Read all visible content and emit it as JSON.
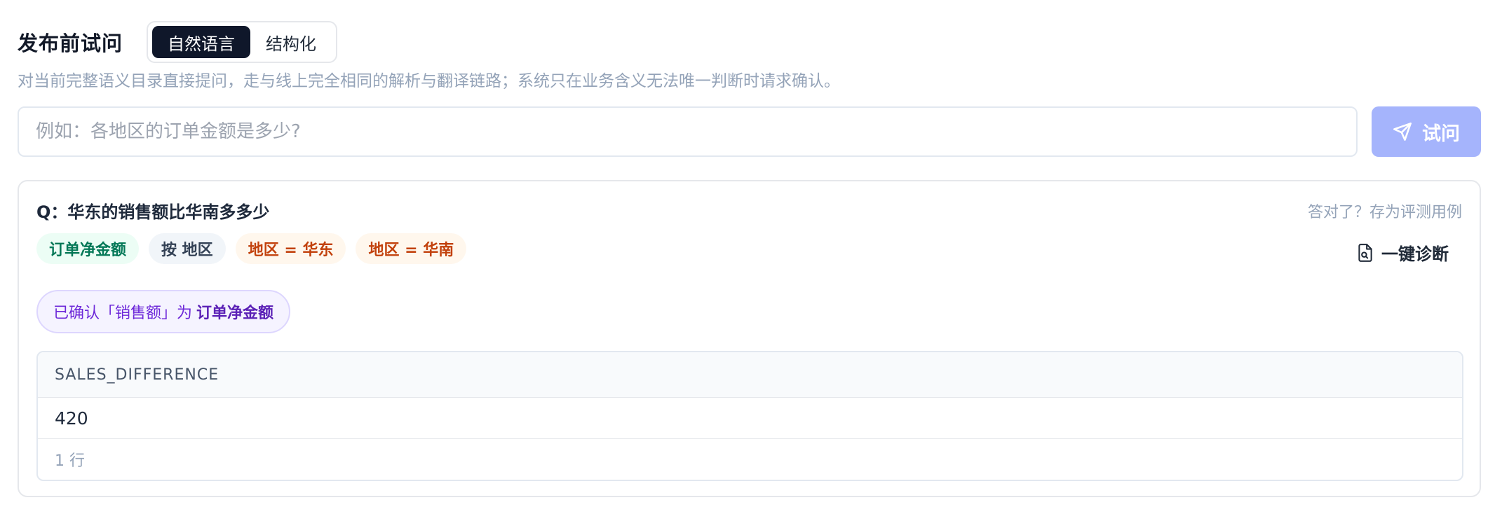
{
  "header": {
    "title": "发布前试问",
    "mode_tabs": [
      {
        "label": "自然语言",
        "active": true
      },
      {
        "label": "结构化",
        "active": false
      }
    ],
    "subtitle": "对当前完整语义目录直接提问，走与线上完全相同的解析与翻译链路；系统只在业务含义无法唯一判断时请求确认。"
  },
  "query": {
    "placeholder": "例如：各地区的订单金额是多少?",
    "value": "",
    "ask_label": "试问",
    "ask_icon": "send-icon",
    "ask_color": "#a5b4fc"
  },
  "result": {
    "question": "Q：华东的销售额比华南多多少",
    "save_label": "答对了？存为评测用例",
    "chips": [
      {
        "label": "订单净金额",
        "kind": "metric"
      },
      {
        "label": "按 地区",
        "kind": "dimension"
      },
      {
        "label": "地区 = 华东",
        "kind": "filter"
      },
      {
        "label": "地区 = 华南",
        "kind": "filter"
      }
    ],
    "diagnose_label": "一键诊断",
    "diagnose_icon": "file-search-icon",
    "confirm_prefix": "已确认「销售额」为",
    "confirm_value": "订单净金额",
    "table": {
      "columns": [
        "SALES_DIFFERENCE"
      ],
      "rows": [
        [
          "420"
        ]
      ],
      "row_count_label": "1 行"
    }
  }
}
